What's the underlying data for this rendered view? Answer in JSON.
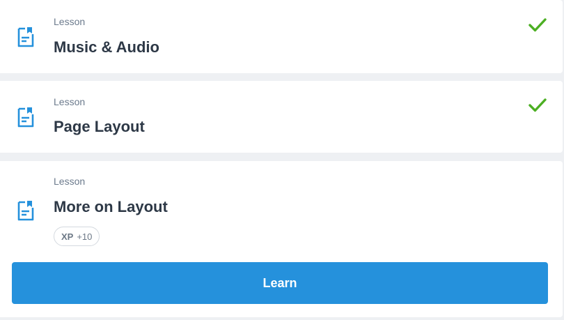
{
  "colors": {
    "accent": "#2591dc",
    "check": "#4caf23",
    "icon": "#2591dc",
    "title": "#2d3846",
    "kicker": "#6b7a8c"
  },
  "lessons": [
    {
      "kicker": "Lesson",
      "title": "Music & Audio",
      "status": "completed",
      "status_icon": "checkmark-icon",
      "icon": "document-icon"
    },
    {
      "kicker": "Lesson",
      "title": "Page Layout",
      "status": "completed",
      "status_icon": "checkmark-icon",
      "icon": "document-icon"
    },
    {
      "kicker": "Lesson",
      "title": "More on Layout",
      "status": "current",
      "icon": "document-icon",
      "xp": {
        "label": "XP",
        "value": "+10"
      },
      "action_label": "Learn"
    }
  ]
}
